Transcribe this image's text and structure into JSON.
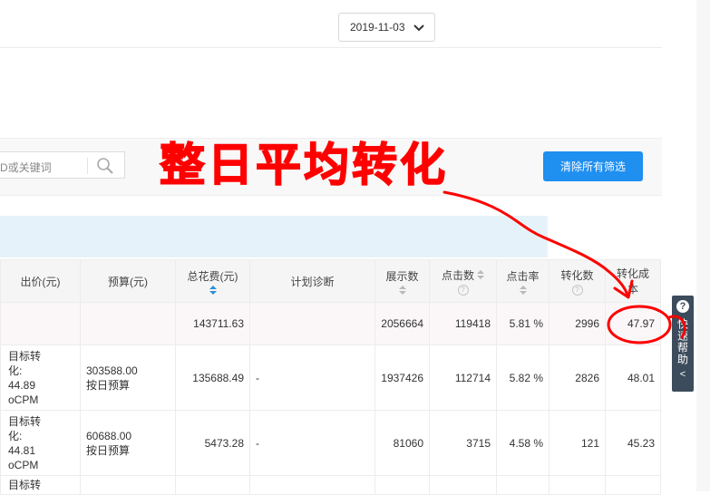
{
  "header": {
    "date": "2019-11-03"
  },
  "filter": {
    "search_placeholder": "D或关键词",
    "clear_label": "清除所有筛选"
  },
  "table": {
    "headers": {
      "bid": "出价(元)",
      "budget": "预算(元)",
      "spend": "总花费(元)",
      "diagnosis": "计划诊断",
      "impressions": "展示数",
      "clicks": "点击数",
      "ctr": "点击率",
      "conversions": "转化数",
      "cost_per_conversion_line1": "转化成",
      "cost_per_conversion_line2": "本"
    },
    "summary": {
      "spend": "143711.63",
      "impressions": "2056664",
      "clicks": "119418",
      "ctr": "5.81 %",
      "conversions": "2996",
      "cost_per_conversion": "47.97"
    },
    "rows": [
      {
        "bid": "目标转\n化:\n44.89\noCPM",
        "budget": "303588.00\n按日预算",
        "spend": "135688.49",
        "diagnosis": "-",
        "impressions": "1937426",
        "clicks": "112714",
        "ctr": "5.82 %",
        "conversions": "2826",
        "cost_per_conversion": "48.01"
      },
      {
        "bid": "目标转\n化:\n44.81\noCPM",
        "budget": "60688.00\n按日预算",
        "spend": "5473.28",
        "diagnosis": "-",
        "impressions": "81060",
        "clicks": "3715",
        "ctr": "4.58 %",
        "conversions": "121",
        "cost_per_conversion": "45.23"
      }
    ],
    "partial_row_bid": "目标转"
  },
  "help_widget": {
    "icon": "?",
    "label": "快速帮助",
    "collapse": "<"
  },
  "annotation": {
    "text": "整日平均转化",
    "color": "#ff0000"
  },
  "colors": {
    "primary_button": "#1f8ff0",
    "sort_active": "#2a8fd8",
    "help_widget_bg": "#3d4c5c"
  }
}
